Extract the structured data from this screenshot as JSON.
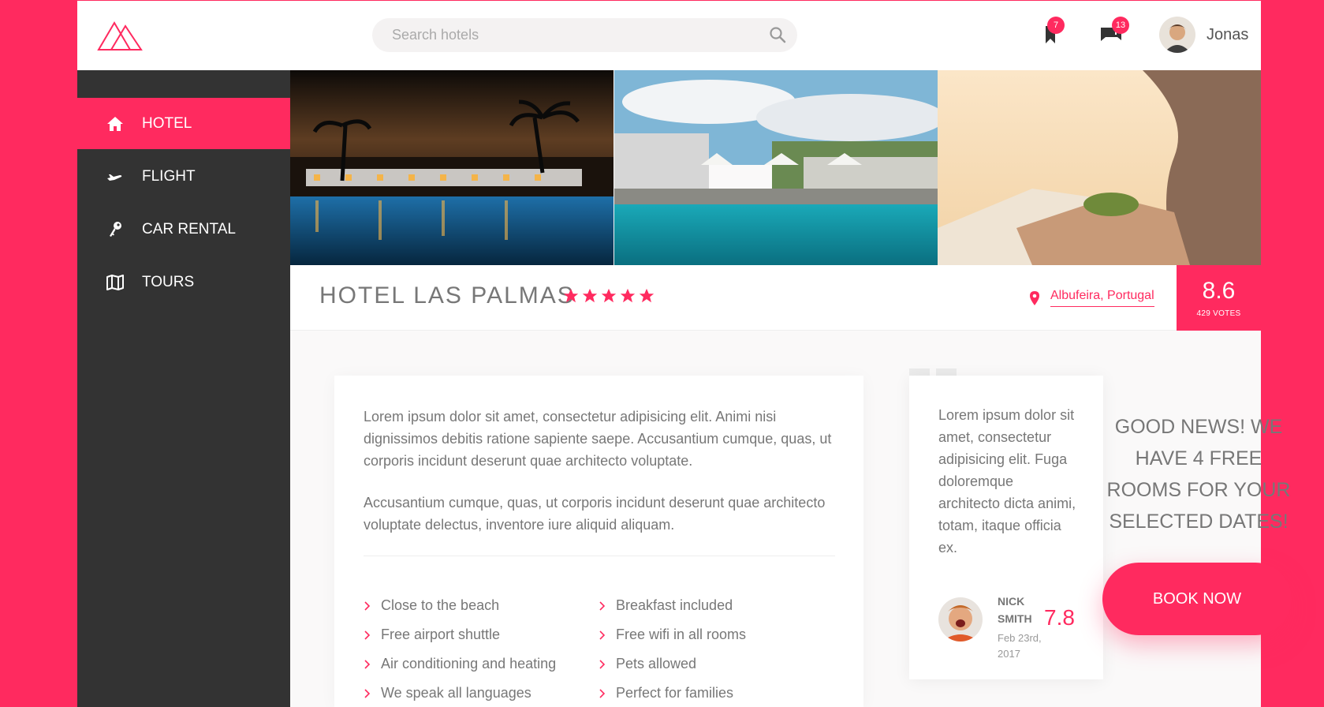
{
  "colors": {
    "accent": "#ff2a5f",
    "sidebar": "#333333",
    "text": "#777777"
  },
  "header": {
    "logo_icon": "mountains-logo-icon",
    "search_placeholder": "Search hotels",
    "bookmarks_badge": "7",
    "messages_badge": "13",
    "user_name": "Jonas"
  },
  "sidebar": {
    "items": [
      {
        "label": "HOTEL",
        "icon": "home-icon",
        "active": true
      },
      {
        "label": "FLIGHT",
        "icon": "airplane-icon",
        "active": false
      },
      {
        "label": "CAR RENTAL",
        "icon": "key-icon",
        "active": false
      },
      {
        "label": "TOURS",
        "icon": "map-icon",
        "active": false
      }
    ]
  },
  "gallery": {
    "photos": [
      "night-pool-photo",
      "day-pool-photo",
      "cliff-terrace-photo"
    ]
  },
  "hotel": {
    "name": "HOTEL LAS PALMAS",
    "stars": 5,
    "location": "Albufeira, Portugal",
    "rating": "8.6",
    "votes": "429 VOTES"
  },
  "description": {
    "paragraph1": "Lorem ipsum dolor sit amet, consectetur adipisicing elit. Animi nisi dignissimos debitis ratione sapiente saepe. Accusantium cumque, quas, ut corporis incidunt deserunt quae architecto voluptate.",
    "paragraph2": "Accusantium cumque, quas, ut corporis incidunt deserunt quae architecto voluptate delectus, inventore iure aliquid aliquam.",
    "features": [
      "Close to the beach",
      "Breakfast included",
      "Free airport shuttle",
      "Free wifi in all rooms",
      "Air conditioning and heating",
      "Pets allowed",
      "We speak all languages",
      "Perfect for families"
    ]
  },
  "review": {
    "text": "Lorem ipsum dolor sit amet, consectetur adipisicing elit. Fuga doloremque architecto dicta animi, totam, itaque officia ex.",
    "name": "NICK SMITH",
    "date": "Feb 23rd, 2017",
    "score": "7.8"
  },
  "cta": {
    "text": "GOOD NEWS! WE HAVE 4 FREE ROOMS FOR YOUR SELECTED DATES!",
    "button": "BOOK NOW"
  }
}
